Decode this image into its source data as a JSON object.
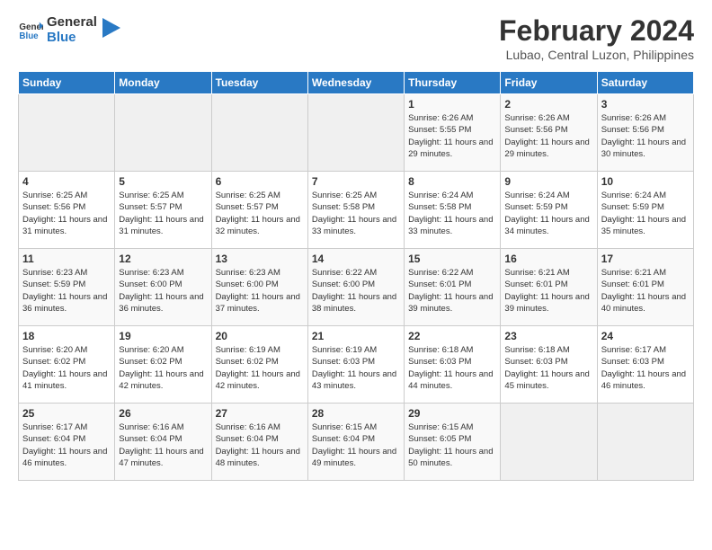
{
  "logo": {
    "text_general": "General",
    "text_blue": "Blue"
  },
  "title": "February 2024",
  "subtitle": "Lubao, Central Luzon, Philippines",
  "days_of_week": [
    "Sunday",
    "Monday",
    "Tuesday",
    "Wednesday",
    "Thursday",
    "Friday",
    "Saturday"
  ],
  "weeks": [
    [
      {
        "day": "",
        "info": ""
      },
      {
        "day": "",
        "info": ""
      },
      {
        "day": "",
        "info": ""
      },
      {
        "day": "",
        "info": ""
      },
      {
        "day": "1",
        "info": "Sunrise: 6:26 AM\nSunset: 5:55 PM\nDaylight: 11 hours and 29 minutes."
      },
      {
        "day": "2",
        "info": "Sunrise: 6:26 AM\nSunset: 5:56 PM\nDaylight: 11 hours and 29 minutes."
      },
      {
        "day": "3",
        "info": "Sunrise: 6:26 AM\nSunset: 5:56 PM\nDaylight: 11 hours and 30 minutes."
      }
    ],
    [
      {
        "day": "4",
        "info": "Sunrise: 6:25 AM\nSunset: 5:56 PM\nDaylight: 11 hours and 31 minutes."
      },
      {
        "day": "5",
        "info": "Sunrise: 6:25 AM\nSunset: 5:57 PM\nDaylight: 11 hours and 31 minutes."
      },
      {
        "day": "6",
        "info": "Sunrise: 6:25 AM\nSunset: 5:57 PM\nDaylight: 11 hours and 32 minutes."
      },
      {
        "day": "7",
        "info": "Sunrise: 6:25 AM\nSunset: 5:58 PM\nDaylight: 11 hours and 33 minutes."
      },
      {
        "day": "8",
        "info": "Sunrise: 6:24 AM\nSunset: 5:58 PM\nDaylight: 11 hours and 33 minutes."
      },
      {
        "day": "9",
        "info": "Sunrise: 6:24 AM\nSunset: 5:59 PM\nDaylight: 11 hours and 34 minutes."
      },
      {
        "day": "10",
        "info": "Sunrise: 6:24 AM\nSunset: 5:59 PM\nDaylight: 11 hours and 35 minutes."
      }
    ],
    [
      {
        "day": "11",
        "info": "Sunrise: 6:23 AM\nSunset: 5:59 PM\nDaylight: 11 hours and 36 minutes."
      },
      {
        "day": "12",
        "info": "Sunrise: 6:23 AM\nSunset: 6:00 PM\nDaylight: 11 hours and 36 minutes."
      },
      {
        "day": "13",
        "info": "Sunrise: 6:23 AM\nSunset: 6:00 PM\nDaylight: 11 hours and 37 minutes."
      },
      {
        "day": "14",
        "info": "Sunrise: 6:22 AM\nSunset: 6:00 PM\nDaylight: 11 hours and 38 minutes."
      },
      {
        "day": "15",
        "info": "Sunrise: 6:22 AM\nSunset: 6:01 PM\nDaylight: 11 hours and 39 minutes."
      },
      {
        "day": "16",
        "info": "Sunrise: 6:21 AM\nSunset: 6:01 PM\nDaylight: 11 hours and 39 minutes."
      },
      {
        "day": "17",
        "info": "Sunrise: 6:21 AM\nSunset: 6:01 PM\nDaylight: 11 hours and 40 minutes."
      }
    ],
    [
      {
        "day": "18",
        "info": "Sunrise: 6:20 AM\nSunset: 6:02 PM\nDaylight: 11 hours and 41 minutes."
      },
      {
        "day": "19",
        "info": "Sunrise: 6:20 AM\nSunset: 6:02 PM\nDaylight: 11 hours and 42 minutes."
      },
      {
        "day": "20",
        "info": "Sunrise: 6:19 AM\nSunset: 6:02 PM\nDaylight: 11 hours and 42 minutes."
      },
      {
        "day": "21",
        "info": "Sunrise: 6:19 AM\nSunset: 6:03 PM\nDaylight: 11 hours and 43 minutes."
      },
      {
        "day": "22",
        "info": "Sunrise: 6:18 AM\nSunset: 6:03 PM\nDaylight: 11 hours and 44 minutes."
      },
      {
        "day": "23",
        "info": "Sunrise: 6:18 AM\nSunset: 6:03 PM\nDaylight: 11 hours and 45 minutes."
      },
      {
        "day": "24",
        "info": "Sunrise: 6:17 AM\nSunset: 6:03 PM\nDaylight: 11 hours and 46 minutes."
      }
    ],
    [
      {
        "day": "25",
        "info": "Sunrise: 6:17 AM\nSunset: 6:04 PM\nDaylight: 11 hours and 46 minutes."
      },
      {
        "day": "26",
        "info": "Sunrise: 6:16 AM\nSunset: 6:04 PM\nDaylight: 11 hours and 47 minutes."
      },
      {
        "day": "27",
        "info": "Sunrise: 6:16 AM\nSunset: 6:04 PM\nDaylight: 11 hours and 48 minutes."
      },
      {
        "day": "28",
        "info": "Sunrise: 6:15 AM\nSunset: 6:04 PM\nDaylight: 11 hours and 49 minutes."
      },
      {
        "day": "29",
        "info": "Sunrise: 6:15 AM\nSunset: 6:05 PM\nDaylight: 11 hours and 50 minutes."
      },
      {
        "day": "",
        "info": ""
      },
      {
        "day": "",
        "info": ""
      }
    ]
  ]
}
